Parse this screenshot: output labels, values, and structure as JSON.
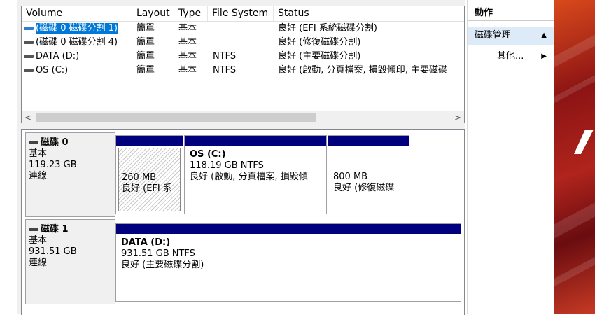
{
  "columns": {
    "volume": "Volume",
    "layout": "Layout",
    "type": "Type",
    "file_system": "File System",
    "status": "Status"
  },
  "volumes": [
    {
      "volume": "(磁碟 0 磁碟分割 1)",
      "layout": "簡單",
      "type": "基本",
      "file_system": "",
      "status": "良好 (EFI 系統磁碟分割)",
      "selected": true
    },
    {
      "volume": "(磁碟 0 磁碟分割 4)",
      "layout": "簡單",
      "type": "基本",
      "file_system": "",
      "status": "良好 (修復磁碟分割)"
    },
    {
      "volume": "DATA (D:)",
      "layout": "簡單",
      "type": "基本",
      "file_system": "NTFS",
      "status": "良好 (主要磁碟分割)"
    },
    {
      "volume": "OS (C:)",
      "layout": "簡單",
      "type": "基本",
      "file_system": "NTFS",
      "status": "良好 (啟動, 分頁檔案, 損毀傾印, 主要磁碟"
    }
  ],
  "scroll": {
    "left_arrow": "<",
    "right_arrow": ">"
  },
  "disks": [
    {
      "title": "磁碟 0",
      "type": "基本",
      "size": "119.23 GB",
      "status": "連線",
      "partitions": [
        {
          "name": "",
          "size": "260 MB",
          "status": "良好 (EFI 系"
        },
        {
          "name": "OS  (C:)",
          "size": "118.19 GB NTFS",
          "status": "良好 (啟動, 分頁檔案, 損毀傾"
        },
        {
          "name": "",
          "size": "800 MB",
          "status": "良好 (修復磁碟"
        }
      ]
    },
    {
      "title": "磁碟 1",
      "type": "基本",
      "size": "931.51 GB",
      "status": "連線",
      "partitions": [
        {
          "name": "DATA  (D:)",
          "size": "931.51 GB NTFS",
          "status": "良好 (主要磁碟分割)"
        }
      ]
    }
  ],
  "actions": {
    "header": "動作",
    "section": "磁碟管理",
    "item": "其他..."
  },
  "colors": {
    "selection": "#0078d7",
    "partition_bar": "#00007e",
    "action_section_bg": "#dcebf7"
  }
}
